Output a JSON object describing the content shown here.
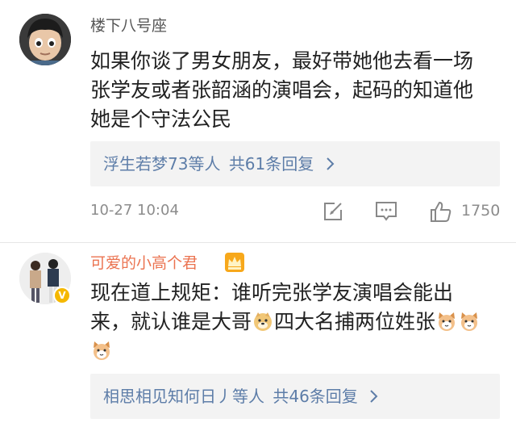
{
  "comments": [
    {
      "username": "楼下八号座",
      "text_lines": [
        "如果你谈了男女朋友，最好带她他去看一场",
        "张学友或者张韶涵的演唱会，起码的知道他",
        "她是个守法公民"
      ],
      "replies": {
        "names": "浮生若梦73等人",
        "total": "共61条回复"
      },
      "time": "10-27 10:04",
      "likes": "1750",
      "icons": [
        "share-icon",
        "comment-icon",
        "like-icon"
      ]
    },
    {
      "username": "可爱的小高个君",
      "badge": "crown-icon",
      "verified": "V",
      "text_line1": "现在道上规矩：谁听完张学友演唱会能出",
      "text_line2_a": "来，就认谁是大哥",
      "text_line2_b": "四大名捕两位姓张",
      "emojis": [
        "doge-emoji",
        "cat-emoji",
        "cat-emoji",
        "cat-emoji"
      ],
      "replies": {
        "names": "相思相见知何日丿等人",
        "total": "共46条回复"
      }
    }
  ],
  "colors": {
    "username_gray": "#555555",
    "username_vip": "#eb7350",
    "link_blue": "#5d7da8",
    "meta_gray": "#8c8c8c",
    "reply_bg": "#f3f3f3"
  }
}
